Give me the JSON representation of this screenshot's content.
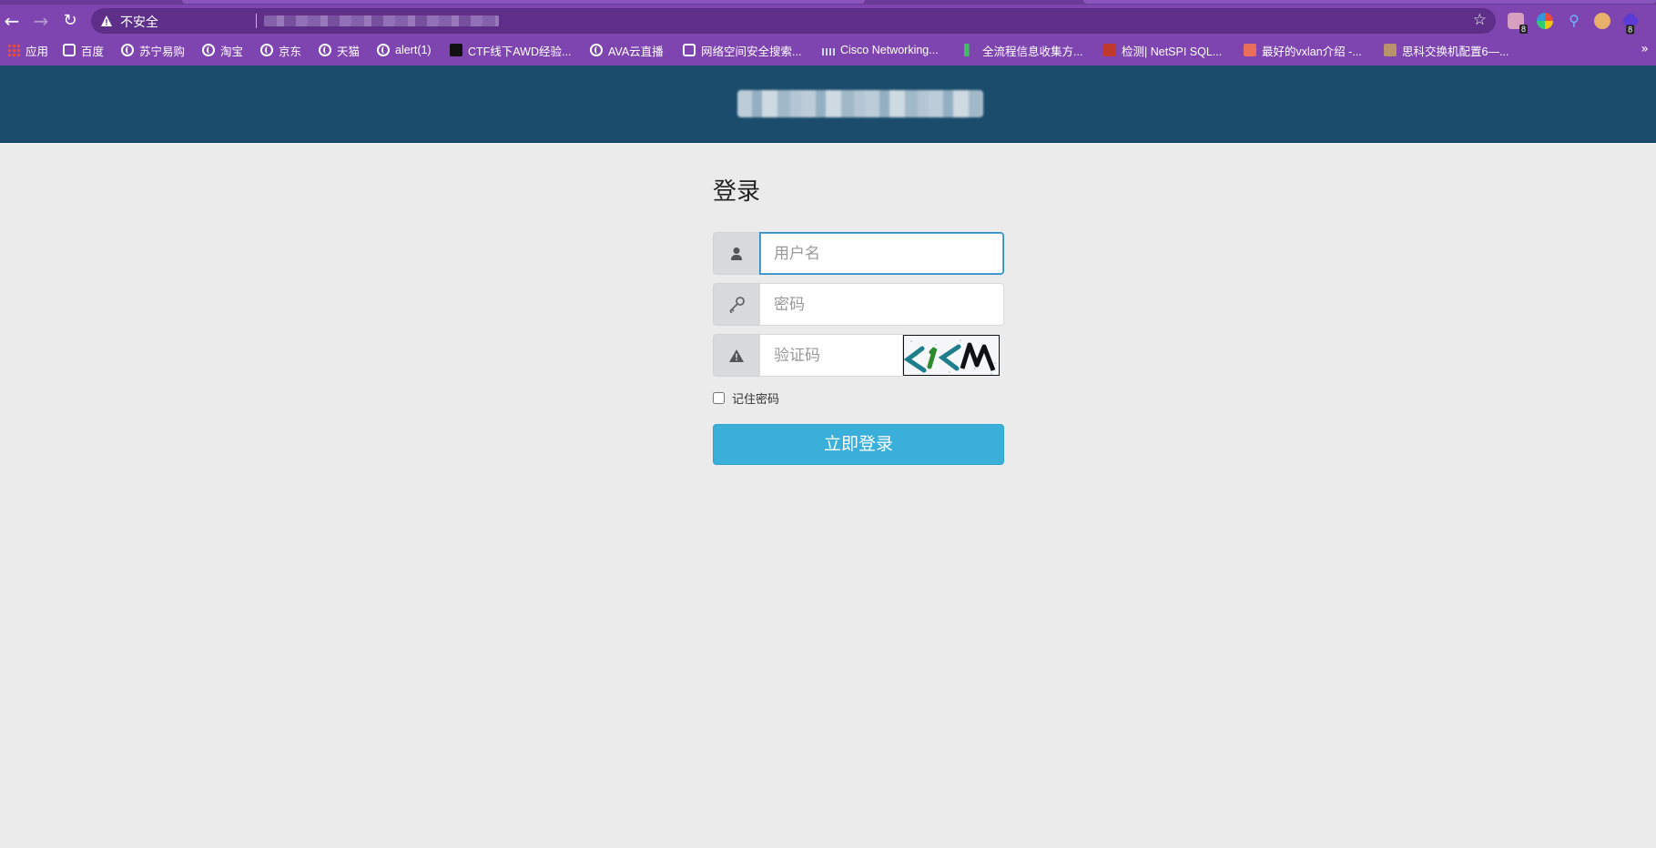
{
  "browser": {
    "security_label": "不安全",
    "bookmarks": [
      {
        "label": "应用",
        "icon": "apps-grid-icon"
      },
      {
        "label": "百度",
        "icon": "baidu-icon"
      },
      {
        "label": "苏宁易购",
        "icon": "globe-icon"
      },
      {
        "label": "淘宝",
        "icon": "globe-icon"
      },
      {
        "label": "京东",
        "icon": "globe-icon"
      },
      {
        "label": "天猫",
        "icon": "globe-icon"
      },
      {
        "label": "alert(1)",
        "icon": "globe-icon"
      },
      {
        "label": "CTF线下AWD经验...",
        "icon": "terminal-icon"
      },
      {
        "label": "AVA云直播",
        "icon": "globe-icon"
      },
      {
        "label": "网络空间安全搜索...",
        "icon": "search-engine-icon"
      },
      {
        "label": "Cisco Networking...",
        "icon": "cisco-icon"
      },
      {
        "label": "全流程信息收集方...",
        "icon": "chart-icon"
      },
      {
        "label": "检测| NetSPI SQL...",
        "icon": "netspi-icon"
      },
      {
        "label": "最好的vxlan介绍 -...",
        "icon": "jianshu-icon"
      },
      {
        "label": "思科交换机配置6—...",
        "icon": "photo-icon"
      }
    ],
    "extension_badges": [
      "8",
      "8"
    ]
  },
  "login": {
    "title": "登录",
    "username_placeholder": "用户名",
    "password_placeholder": "密码",
    "captcha_placeholder": "验证码",
    "remember_label": "记住密码",
    "submit_label": "立即登录"
  }
}
